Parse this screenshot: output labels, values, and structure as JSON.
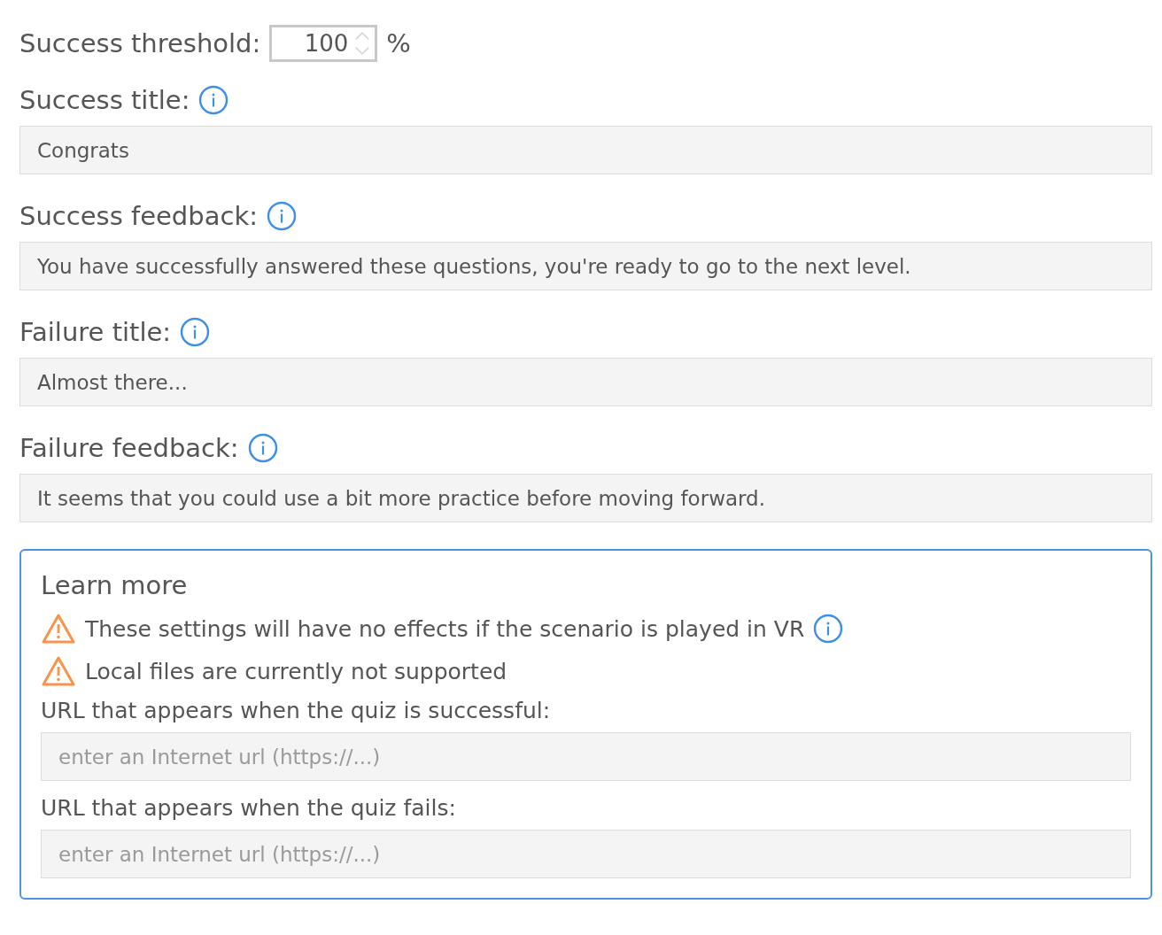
{
  "threshold": {
    "label": "Success threshold:",
    "value": "100",
    "unit": "%"
  },
  "fields": [
    {
      "label": "Success title:",
      "info": true,
      "value": "Congrats"
    },
    {
      "label": "Success feedback:",
      "info": true,
      "value": "You have successfully answered these questions, you're ready to go to the next level."
    },
    {
      "label": "Failure title:",
      "info": true,
      "value": "Almost there..."
    },
    {
      "label": "Failure feedback:",
      "info": true,
      "value": "It seems that you could use a bit more practice before moving forward."
    }
  ],
  "learn_more": {
    "title": "Learn more",
    "warnings": [
      {
        "text": "These settings will have no effects if the scenario is played in VR",
        "info": true
      },
      {
        "text": "Local files are currently not supported",
        "info": false
      }
    ],
    "url_fields": [
      {
        "label": "URL that appears when the quiz is successful:",
        "placeholder": "enter an Internet url (https://...)"
      },
      {
        "label": "URL that appears when the quiz fails:",
        "placeholder": "enter an Internet url (https://...)"
      }
    ]
  }
}
